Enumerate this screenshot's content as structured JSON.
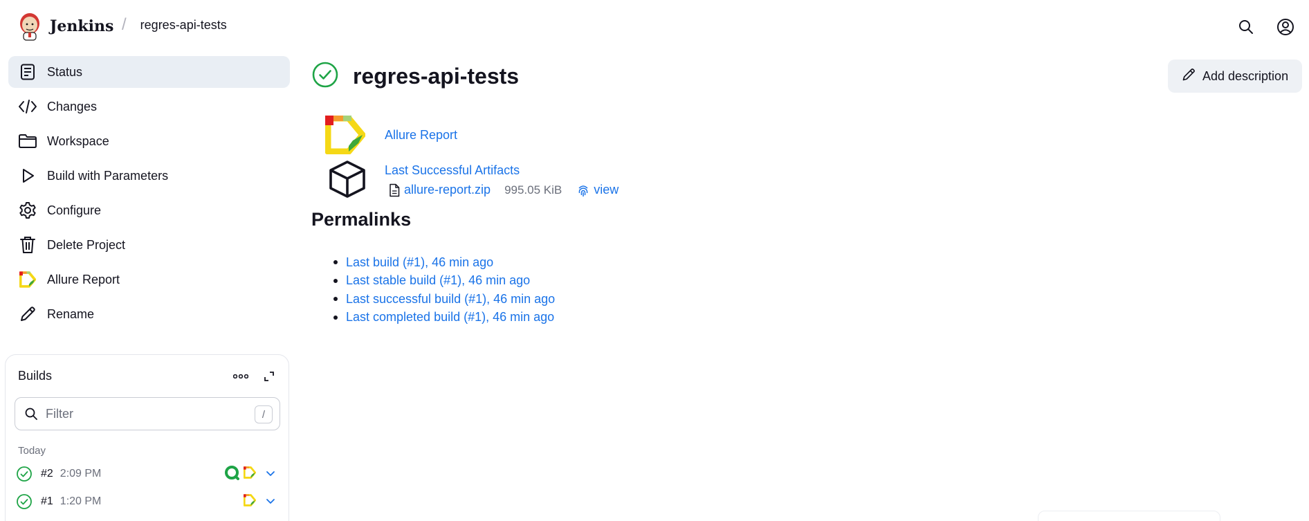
{
  "header": {
    "app_name": "Jenkins",
    "breadcrumb_separator": "/",
    "breadcrumb_project": "regres-api-tests",
    "icons": [
      "search-icon",
      "user-icon"
    ]
  },
  "sidebar": {
    "items": [
      {
        "label": "Status",
        "icon": "status-icon",
        "active": true
      },
      {
        "label": "Changes",
        "icon": "code-icon"
      },
      {
        "label": "Workspace",
        "icon": "folder-icon"
      },
      {
        "label": "Build with Parameters",
        "icon": "play-icon"
      },
      {
        "label": "Configure",
        "icon": "gear-icon"
      },
      {
        "label": "Delete Project",
        "icon": "trash-icon"
      },
      {
        "label": "Allure Report",
        "icon": "allure-icon"
      },
      {
        "label": "Rename",
        "icon": "pencil-icon"
      }
    ]
  },
  "builds": {
    "title": "Builds",
    "filter_placeholder": "Filter",
    "filter_shortcut": "/",
    "group_label": "Today",
    "rows": [
      {
        "number": "#2",
        "time": "2:09 PM",
        "status": "success",
        "badges": [
          "console-icon",
          "allure-icon"
        ]
      },
      {
        "number": "#1",
        "time": "1:20 PM",
        "status": "success",
        "badges": [
          "allure-icon"
        ]
      }
    ]
  },
  "main": {
    "project_title": "regres-api-tests",
    "status": "success",
    "add_description_label": "Add description",
    "allure_report_label": "Allure Report",
    "last_artifacts_label": "Last Successful Artifacts",
    "artifact": {
      "file_name": "allure-report.zip",
      "file_size": "995.05 KiB",
      "view_label": "view"
    },
    "permalinks_heading": "Permalinks",
    "permalinks": [
      "Last build (#1), 46 min ago",
      "Last stable build (#1), 46 min ago",
      "Last successful build (#1), 46 min ago",
      "Last completed build (#1), 46 min ago"
    ]
  },
  "colors": {
    "link": "#1a73e8",
    "success": "#1ea446",
    "active_bg": "#e9eef4",
    "muted": "#6b6f7b"
  }
}
